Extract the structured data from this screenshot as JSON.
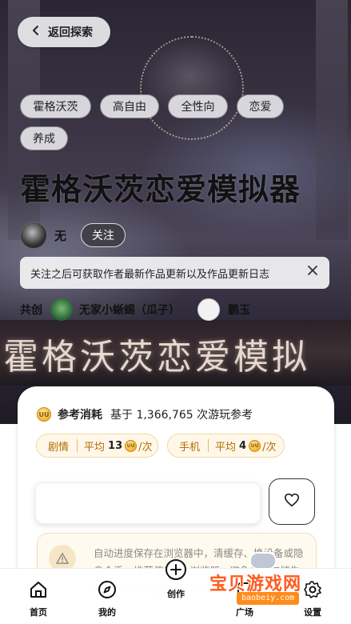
{
  "header": {
    "back_label": "返回探索"
  },
  "tags": [
    "霍格沃茨",
    "高自由",
    "全性向",
    "恋爱",
    "养成"
  ],
  "work": {
    "title": "霍格沃茨恋爱模拟器",
    "banner_text": "霍格沃茨恋爱模拟"
  },
  "author": {
    "name": "无",
    "follow_label": "关注"
  },
  "follow_tip": "关注之后可获取作者最新作品更新以及作品更新日志",
  "cocreate": {
    "label": "共创",
    "members": [
      "无家小蜥蜴（瓜子）",
      "鹏玉"
    ]
  },
  "cost": {
    "title": "参考消耗",
    "subtitle": "基于 1,366,765 次游玩参考",
    "coin_text": "UU",
    "pills": [
      {
        "label": "剧情",
        "avg_label": "平均",
        "value": "13",
        "per": "/次"
      },
      {
        "label": "手机",
        "avg_label": "平均",
        "value": "4",
        "per": "/次"
      }
    ]
  },
  "notice": {
    "text": "自动进度保存在浏览器中，清缓存、换设备或隐身会丢。推荐使用 … 浏览器，避免自动存储失效 … 点进行存储档（离线）"
  },
  "nav": {
    "items": [
      {
        "label": "首页",
        "icon": "home-icon"
      },
      {
        "label": "我的",
        "icon": "compass-icon"
      },
      {
        "label": "创作",
        "icon": "create-icon"
      },
      {
        "label": "广场",
        "icon": "square-icon"
      },
      {
        "label": "设置",
        "icon": "settings-icon"
      }
    ]
  },
  "watermark": {
    "title": "宝贝游戏网",
    "url": "baobeiy.com"
  },
  "colors": {
    "accent": "#f2b52a",
    "pill_text": "#b36b00",
    "watermark": "#ff5a1f"
  }
}
